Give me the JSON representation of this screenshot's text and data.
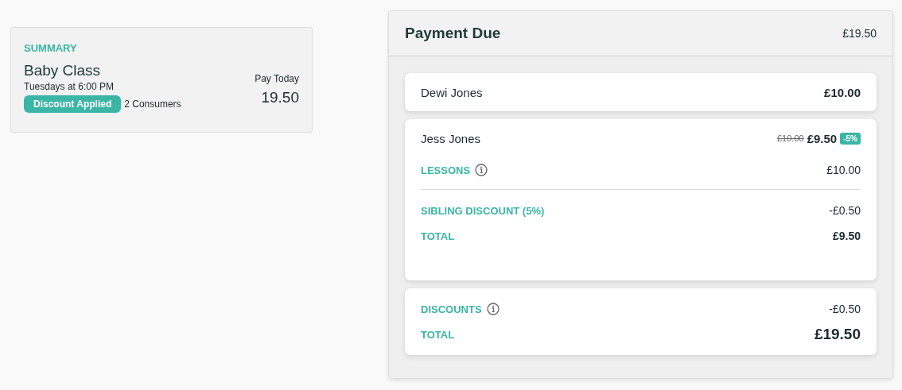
{
  "summary": {
    "heading": "SUMMARY",
    "class_name": "Baby Class",
    "schedule": "Tuesdays at 6:00 PM",
    "badge": "Discount Applied",
    "consumers": "2 Consumers",
    "pay_label": "Pay Today",
    "pay_amount": "19.50"
  },
  "payment": {
    "title": "Payment Due",
    "amount": "£19.50",
    "consumers": [
      {
        "name": "Dewi Jones",
        "expanded": false,
        "price": "£10.00"
      },
      {
        "name": "Jess Jones",
        "expanded": true,
        "old_price": "£10.00",
        "price": "£9.50",
        "badge": "-5%",
        "lines": [
          {
            "kind": "charge",
            "label": "LESSONS",
            "info": true,
            "amount": "£10.00"
          },
          {
            "kind": "discount",
            "label": "SIBLING DISCOUNT (5%)",
            "info": false,
            "amount": "-£0.50"
          },
          {
            "kind": "total",
            "label": "TOTAL",
            "info": false,
            "amount": "£9.50"
          }
        ]
      }
    ],
    "totals": [
      {
        "kind": "discount",
        "label": "DISCOUNTS",
        "info": true,
        "amount": "-£0.50"
      },
      {
        "kind": "total",
        "label": "TOTAL",
        "info": false,
        "amount": "£19.50"
      }
    ]
  }
}
